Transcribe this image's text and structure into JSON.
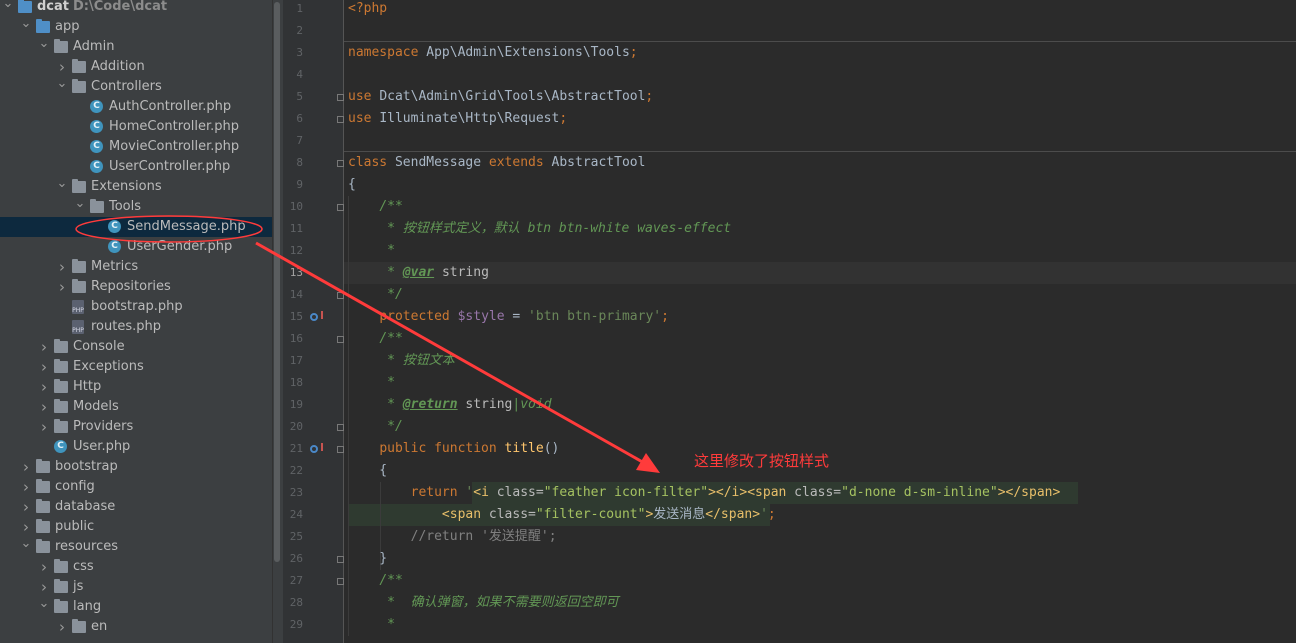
{
  "project_tree": {
    "items": [
      {
        "label": "dcat",
        "path": "D:\\Code\\dcat",
        "depth": 0,
        "expanded": true,
        "kind": "project"
      },
      {
        "label": "app",
        "depth": 1,
        "expanded": true,
        "kind": "folder-blue"
      },
      {
        "label": "Admin",
        "depth": 2,
        "expanded": true,
        "kind": "folder"
      },
      {
        "label": "Addition",
        "depth": 3,
        "expanded": false,
        "kind": "folder"
      },
      {
        "label": "Controllers",
        "depth": 3,
        "expanded": true,
        "kind": "folder"
      },
      {
        "label": "AuthController.php",
        "depth": 4,
        "kind": "class"
      },
      {
        "label": "HomeController.php",
        "depth": 4,
        "kind": "class"
      },
      {
        "label": "MovieController.php",
        "depth": 4,
        "kind": "class"
      },
      {
        "label": "UserController.php",
        "depth": 4,
        "kind": "class"
      },
      {
        "label": "Extensions",
        "depth": 3,
        "expanded": true,
        "kind": "folder"
      },
      {
        "label": "Tools",
        "depth": 4,
        "expanded": true,
        "kind": "folder"
      },
      {
        "label": "SendMessage.php",
        "depth": 5,
        "kind": "class",
        "selected": true
      },
      {
        "label": "UserGender.php",
        "depth": 5,
        "kind": "class"
      },
      {
        "label": "Metrics",
        "depth": 3,
        "expanded": false,
        "kind": "folder"
      },
      {
        "label": "Repositories",
        "depth": 3,
        "expanded": false,
        "kind": "folder"
      },
      {
        "label": "bootstrap.php",
        "depth": 3,
        "kind": "php"
      },
      {
        "label": "routes.php",
        "depth": 3,
        "kind": "php"
      },
      {
        "label": "Console",
        "depth": 2,
        "expanded": false,
        "kind": "folder"
      },
      {
        "label": "Exceptions",
        "depth": 2,
        "expanded": false,
        "kind": "folder"
      },
      {
        "label": "Http",
        "depth": 2,
        "expanded": false,
        "kind": "folder"
      },
      {
        "label": "Models",
        "depth": 2,
        "expanded": false,
        "kind": "folder"
      },
      {
        "label": "Providers",
        "depth": 2,
        "expanded": false,
        "kind": "folder"
      },
      {
        "label": "User.php",
        "depth": 2,
        "kind": "class"
      },
      {
        "label": "bootstrap",
        "depth": 1,
        "expanded": false,
        "kind": "folder"
      },
      {
        "label": "config",
        "depth": 1,
        "expanded": false,
        "kind": "folder"
      },
      {
        "label": "database",
        "depth": 1,
        "expanded": false,
        "kind": "folder"
      },
      {
        "label": "public",
        "depth": 1,
        "expanded": false,
        "kind": "folder"
      },
      {
        "label": "resources",
        "depth": 1,
        "expanded": true,
        "kind": "folder"
      },
      {
        "label": "css",
        "depth": 2,
        "expanded": false,
        "kind": "folder"
      },
      {
        "label": "js",
        "depth": 2,
        "expanded": false,
        "kind": "folder"
      },
      {
        "label": "lang",
        "depth": 2,
        "expanded": true,
        "kind": "folder"
      },
      {
        "label": "en",
        "depth": 3,
        "expanded": false,
        "kind": "folder"
      }
    ]
  },
  "editor": {
    "lines": [
      {
        "n": "1",
        "parts": [
          [
            "kw",
            "<?php"
          ]
        ]
      },
      {
        "n": "2",
        "parts": []
      },
      {
        "n": "3",
        "parts": [
          [
            "kw",
            "namespace "
          ],
          [
            "",
            "App\\Admin\\Extensions\\Tools"
          ],
          [
            "kw",
            ";"
          ]
        ]
      },
      {
        "n": "4",
        "parts": []
      },
      {
        "n": "5",
        "parts": [
          [
            "kw",
            "use "
          ],
          [
            "",
            "Dcat\\Admin\\Grid\\Tools\\AbstractTool"
          ],
          [
            "kw",
            ";"
          ]
        ]
      },
      {
        "n": "6",
        "parts": [
          [
            "kw",
            "use "
          ],
          [
            "",
            "Illuminate\\Http\\Request"
          ],
          [
            "kw",
            ";"
          ]
        ]
      },
      {
        "n": "7",
        "parts": []
      },
      {
        "n": "8",
        "parts": [
          [
            "kw",
            "class "
          ],
          [
            "",
            "SendMessage "
          ],
          [
            "kw",
            "extends "
          ],
          [
            "",
            "AbstractTool"
          ]
        ]
      },
      {
        "n": "9",
        "parts": [
          [
            "",
            "{"
          ]
        ]
      },
      {
        "n": "10",
        "parts": [
          [
            "",
            "    "
          ],
          [
            "cm",
            "/**"
          ]
        ]
      },
      {
        "n": "11",
        "parts": [
          [
            "",
            "    "
          ],
          [
            "cm",
            " * 按钮样式定义，默认 btn btn-white waves-effect"
          ]
        ]
      },
      {
        "n": "12",
        "parts": [
          [
            "",
            "    "
          ],
          [
            "cm",
            " *"
          ]
        ]
      },
      {
        "n": "13",
        "parts": [
          [
            "",
            "    "
          ],
          [
            "cm",
            " * "
          ],
          [
            "tagdoc",
            "@var"
          ],
          [
            "cm",
            " "
          ],
          [
            "attr",
            "string"
          ]
        ]
      },
      {
        "n": "14",
        "parts": [
          [
            "",
            "    "
          ],
          [
            "cm",
            " */"
          ]
        ]
      },
      {
        "n": "15",
        "parts": [
          [
            "",
            "    "
          ],
          [
            "kw",
            "protected "
          ],
          [
            "var",
            "$style"
          ],
          [
            "",
            " = "
          ],
          [
            "str",
            "'btn btn-primary'"
          ],
          [
            "kw",
            ";"
          ]
        ]
      },
      {
        "n": "16",
        "parts": [
          [
            "",
            "    "
          ],
          [
            "cm",
            "/**"
          ]
        ]
      },
      {
        "n": "17",
        "parts": [
          [
            "",
            "    "
          ],
          [
            "cm",
            " * 按钮文本"
          ]
        ]
      },
      {
        "n": "18",
        "parts": [
          [
            "",
            "    "
          ],
          [
            "cm",
            " *"
          ]
        ]
      },
      {
        "n": "19",
        "parts": [
          [
            "",
            "    "
          ],
          [
            "cm",
            " * "
          ],
          [
            "tagdoc",
            "@return"
          ],
          [
            "cm",
            " "
          ],
          [
            "attr",
            "string"
          ],
          [
            "cm",
            "|void"
          ]
        ]
      },
      {
        "n": "20",
        "parts": [
          [
            "",
            "    "
          ],
          [
            "cm",
            " */"
          ]
        ]
      },
      {
        "n": "21",
        "parts": [
          [
            "",
            "    "
          ],
          [
            "kw",
            "public function "
          ],
          [
            "fn",
            "title"
          ],
          [
            "",
            "()"
          ]
        ]
      },
      {
        "n": "22",
        "parts": [
          [
            "",
            "    {"
          ]
        ]
      },
      {
        "n": "23",
        "parts": [
          [
            "",
            "        "
          ],
          [
            "kw",
            "return "
          ],
          [
            "str",
            "'"
          ],
          [
            "tag",
            "<i "
          ],
          [
            "attr",
            "class="
          ],
          [
            "aval",
            "\"feather icon-filter\""
          ],
          [
            "tag",
            "></i><span "
          ],
          [
            "attr",
            "class="
          ],
          [
            "aval",
            "\"d-none d-sm-inline\""
          ],
          [
            "tag",
            "></span>"
          ]
        ]
      },
      {
        "n": "24",
        "parts": [
          [
            "",
            "            "
          ],
          [
            "tag",
            "<span "
          ],
          [
            "attr",
            "class="
          ],
          [
            "aval",
            "\"filter-count\""
          ],
          [
            "tag",
            ">"
          ],
          [
            "",
            "发送消息"
          ],
          [
            "tag",
            "</span>"
          ],
          [
            "str",
            "'"
          ],
          [
            "kw",
            ";"
          ]
        ]
      },
      {
        "n": "25",
        "parts": [
          [
            "",
            "        "
          ],
          [
            "lcm",
            "//return '发送提醒';"
          ]
        ]
      },
      {
        "n": "26",
        "parts": [
          [
            "",
            "    }"
          ]
        ]
      },
      {
        "n": "27",
        "parts": [
          [
            "",
            "    "
          ],
          [
            "cm",
            "/**"
          ]
        ]
      },
      {
        "n": "28",
        "parts": [
          [
            "",
            "    "
          ],
          [
            "cm",
            " *  确认弹窗，如果不需要则返回空即可"
          ]
        ]
      },
      {
        "n": "29",
        "parts": [
          [
            "",
            "    "
          ],
          [
            "cm",
            " *"
          ]
        ]
      }
    ]
  },
  "annotation": {
    "note": "这里修改了按钮样式",
    "color": "#ff3b3b"
  },
  "colors": {
    "tree_bg": "#3c3f41",
    "editor_bg": "#2b2b2b",
    "gutter_bg": "#313335",
    "selected_row": "#0d293e"
  }
}
